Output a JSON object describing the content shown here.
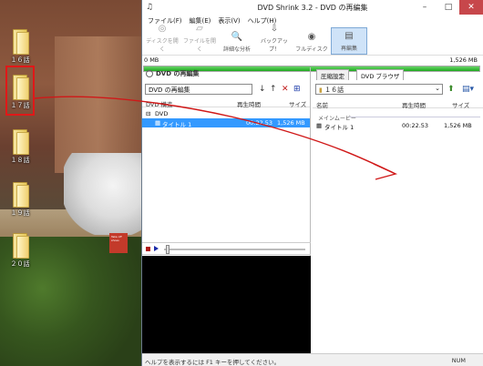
{
  "desktop": {
    "icons": [
      "１６話",
      "１７話",
      "１８話",
      "１９話",
      "２０話"
    ],
    "sign_text": "Take off shoes"
  },
  "window": {
    "title": "DVD Shrink 3.2 - DVD の再編集",
    "menu": [
      "ファイル(F)",
      "編集(E)",
      "表示(V)",
      "ヘルプ(H)"
    ],
    "toolbar": [
      {
        "label": "ディスクを開く",
        "icon": "disc-open-icon",
        "glyph": "◎",
        "enabled": false
      },
      {
        "label": "ファイルを開く",
        "icon": "file-open-icon",
        "glyph": "▱",
        "enabled": false
      },
      {
        "label": "詳細な分析",
        "icon": "analysis-icon",
        "glyph": "🔍",
        "enabled": true
      },
      {
        "label": "バックアップ！",
        "icon": "backup-icon",
        "glyph": "⇩",
        "enabled": true
      },
      {
        "label": "フルディスク",
        "icon": "full-disc-icon",
        "glyph": "◉",
        "enabled": true
      },
      {
        "label": "再編集",
        "icon": "reauthor-icon",
        "glyph": "▤",
        "enabled": true,
        "active": true
      }
    ],
    "size": {
      "min": "0 MB",
      "max": "1,526 MB",
      "fill": 1.0,
      "color": "#1faa1f"
    },
    "left": {
      "header": "DVD の再編集",
      "name_value": "DVD の再編集",
      "tool_icons": [
        "arrow-down-icon",
        "arrow-up-icon",
        "delete-x-icon",
        "split-icon"
      ],
      "columns": {
        "name": "DVD 構造",
        "time": "再生時間",
        "size": "サイズ"
      },
      "tree": {
        "root": "DVD",
        "item": {
          "name": "タイトル 1",
          "time": "00:22.53",
          "size": "1,526 MB"
        }
      }
    },
    "right": {
      "tabs": [
        "圧縮設定",
        "DVD ブラウザ"
      ],
      "folder": "１６話",
      "columns": {
        "name": "名前",
        "time": "再生時間",
        "size": "サイズ"
      },
      "group": "メインムービー",
      "item": {
        "name": "タイトル 1",
        "time": "00:22.53",
        "size": "1,526 MB"
      }
    },
    "status": {
      "message": "ヘルプを表示するには F1 キーを押してください。",
      "num": "NUM"
    }
  }
}
